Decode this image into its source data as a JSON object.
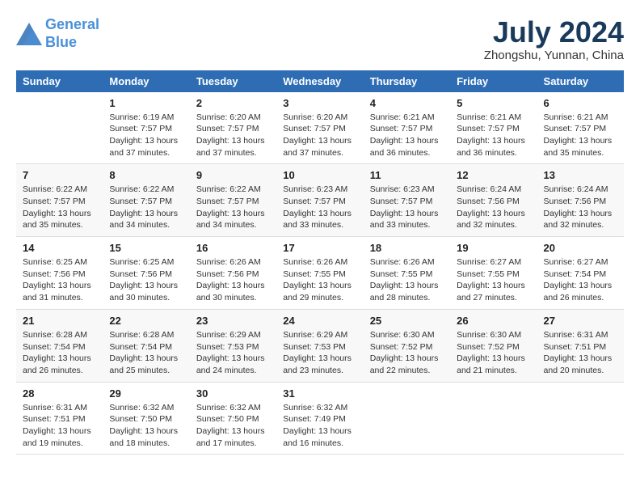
{
  "header": {
    "logo_line1": "General",
    "logo_line2": "Blue",
    "month_year": "July 2024",
    "location": "Zhongshu, Yunnan, China"
  },
  "days_of_week": [
    "Sunday",
    "Monday",
    "Tuesday",
    "Wednesday",
    "Thursday",
    "Friday",
    "Saturday"
  ],
  "weeks": [
    [
      {
        "day": "",
        "sunrise": "",
        "sunset": "",
        "daylight": ""
      },
      {
        "day": "1",
        "sunrise": "Sunrise: 6:19 AM",
        "sunset": "Sunset: 7:57 PM",
        "daylight": "Daylight: 13 hours and 37 minutes."
      },
      {
        "day": "2",
        "sunrise": "Sunrise: 6:20 AM",
        "sunset": "Sunset: 7:57 PM",
        "daylight": "Daylight: 13 hours and 37 minutes."
      },
      {
        "day": "3",
        "sunrise": "Sunrise: 6:20 AM",
        "sunset": "Sunset: 7:57 PM",
        "daylight": "Daylight: 13 hours and 37 minutes."
      },
      {
        "day": "4",
        "sunrise": "Sunrise: 6:21 AM",
        "sunset": "Sunset: 7:57 PM",
        "daylight": "Daylight: 13 hours and 36 minutes."
      },
      {
        "day": "5",
        "sunrise": "Sunrise: 6:21 AM",
        "sunset": "Sunset: 7:57 PM",
        "daylight": "Daylight: 13 hours and 36 minutes."
      },
      {
        "day": "6",
        "sunrise": "Sunrise: 6:21 AM",
        "sunset": "Sunset: 7:57 PM",
        "daylight": "Daylight: 13 hours and 35 minutes."
      }
    ],
    [
      {
        "day": "7",
        "sunrise": "Sunrise: 6:22 AM",
        "sunset": "Sunset: 7:57 PM",
        "daylight": "Daylight: 13 hours and 35 minutes."
      },
      {
        "day": "8",
        "sunrise": "Sunrise: 6:22 AM",
        "sunset": "Sunset: 7:57 PM",
        "daylight": "Daylight: 13 hours and 34 minutes."
      },
      {
        "day": "9",
        "sunrise": "Sunrise: 6:22 AM",
        "sunset": "Sunset: 7:57 PM",
        "daylight": "Daylight: 13 hours and 34 minutes."
      },
      {
        "day": "10",
        "sunrise": "Sunrise: 6:23 AM",
        "sunset": "Sunset: 7:57 PM",
        "daylight": "Daylight: 13 hours and 33 minutes."
      },
      {
        "day": "11",
        "sunrise": "Sunrise: 6:23 AM",
        "sunset": "Sunset: 7:57 PM",
        "daylight": "Daylight: 13 hours and 33 minutes."
      },
      {
        "day": "12",
        "sunrise": "Sunrise: 6:24 AM",
        "sunset": "Sunset: 7:56 PM",
        "daylight": "Daylight: 13 hours and 32 minutes."
      },
      {
        "day": "13",
        "sunrise": "Sunrise: 6:24 AM",
        "sunset": "Sunset: 7:56 PM",
        "daylight": "Daylight: 13 hours and 32 minutes."
      }
    ],
    [
      {
        "day": "14",
        "sunrise": "Sunrise: 6:25 AM",
        "sunset": "Sunset: 7:56 PM",
        "daylight": "Daylight: 13 hours and 31 minutes."
      },
      {
        "day": "15",
        "sunrise": "Sunrise: 6:25 AM",
        "sunset": "Sunset: 7:56 PM",
        "daylight": "Daylight: 13 hours and 30 minutes."
      },
      {
        "day": "16",
        "sunrise": "Sunrise: 6:26 AM",
        "sunset": "Sunset: 7:56 PM",
        "daylight": "Daylight: 13 hours and 30 minutes."
      },
      {
        "day": "17",
        "sunrise": "Sunrise: 6:26 AM",
        "sunset": "Sunset: 7:55 PM",
        "daylight": "Daylight: 13 hours and 29 minutes."
      },
      {
        "day": "18",
        "sunrise": "Sunrise: 6:26 AM",
        "sunset": "Sunset: 7:55 PM",
        "daylight": "Daylight: 13 hours and 28 minutes."
      },
      {
        "day": "19",
        "sunrise": "Sunrise: 6:27 AM",
        "sunset": "Sunset: 7:55 PM",
        "daylight": "Daylight: 13 hours and 27 minutes."
      },
      {
        "day": "20",
        "sunrise": "Sunrise: 6:27 AM",
        "sunset": "Sunset: 7:54 PM",
        "daylight": "Daylight: 13 hours and 26 minutes."
      }
    ],
    [
      {
        "day": "21",
        "sunrise": "Sunrise: 6:28 AM",
        "sunset": "Sunset: 7:54 PM",
        "daylight": "Daylight: 13 hours and 26 minutes."
      },
      {
        "day": "22",
        "sunrise": "Sunrise: 6:28 AM",
        "sunset": "Sunset: 7:54 PM",
        "daylight": "Daylight: 13 hours and 25 minutes."
      },
      {
        "day": "23",
        "sunrise": "Sunrise: 6:29 AM",
        "sunset": "Sunset: 7:53 PM",
        "daylight": "Daylight: 13 hours and 24 minutes."
      },
      {
        "day": "24",
        "sunrise": "Sunrise: 6:29 AM",
        "sunset": "Sunset: 7:53 PM",
        "daylight": "Daylight: 13 hours and 23 minutes."
      },
      {
        "day": "25",
        "sunrise": "Sunrise: 6:30 AM",
        "sunset": "Sunset: 7:52 PM",
        "daylight": "Daylight: 13 hours and 22 minutes."
      },
      {
        "day": "26",
        "sunrise": "Sunrise: 6:30 AM",
        "sunset": "Sunset: 7:52 PM",
        "daylight": "Daylight: 13 hours and 21 minutes."
      },
      {
        "day": "27",
        "sunrise": "Sunrise: 6:31 AM",
        "sunset": "Sunset: 7:51 PM",
        "daylight": "Daylight: 13 hours and 20 minutes."
      }
    ],
    [
      {
        "day": "28",
        "sunrise": "Sunrise: 6:31 AM",
        "sunset": "Sunset: 7:51 PM",
        "daylight": "Daylight: 13 hours and 19 minutes."
      },
      {
        "day": "29",
        "sunrise": "Sunrise: 6:32 AM",
        "sunset": "Sunset: 7:50 PM",
        "daylight": "Daylight: 13 hours and 18 minutes."
      },
      {
        "day": "30",
        "sunrise": "Sunrise: 6:32 AM",
        "sunset": "Sunset: 7:50 PM",
        "daylight": "Daylight: 13 hours and 17 minutes."
      },
      {
        "day": "31",
        "sunrise": "Sunrise: 6:32 AM",
        "sunset": "Sunset: 7:49 PM",
        "daylight": "Daylight: 13 hours and 16 minutes."
      },
      {
        "day": "",
        "sunrise": "",
        "sunset": "",
        "daylight": ""
      },
      {
        "day": "",
        "sunrise": "",
        "sunset": "",
        "daylight": ""
      },
      {
        "day": "",
        "sunrise": "",
        "sunset": "",
        "daylight": ""
      }
    ]
  ]
}
